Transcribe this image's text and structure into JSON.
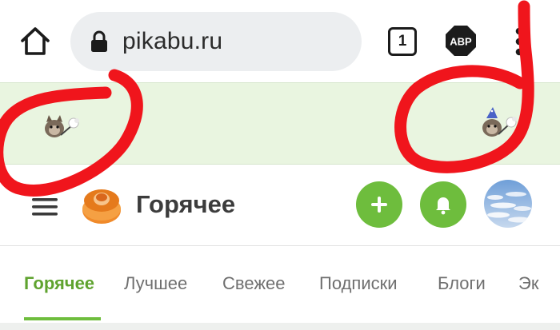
{
  "browser": {
    "url": "pikabu.ru",
    "tab_count": "1",
    "adblock_label": "ABP"
  },
  "header": {
    "title": "Горячее"
  },
  "nav": {
    "tabs": [
      {
        "label": "Горячее"
      },
      {
        "label": "Лучшее"
      },
      {
        "label": "Свежее"
      },
      {
        "label": "Подписки"
      },
      {
        "label": "Блоги"
      },
      {
        "label": "Эк"
      }
    ]
  },
  "colors": {
    "accent_green": "#6ebd3d",
    "active_tab": "#5fa32f",
    "banner_bg": "#e9f5e0",
    "annotation_red": "#f0151c"
  },
  "icons": {
    "home": "home-icon",
    "lock": "lock-icon",
    "tabs": "tabs-count-icon",
    "adblock": "abp-icon",
    "menu": "more-vert-icon",
    "hamburger": "hamburger-icon",
    "add": "plus-icon",
    "bell": "bell-icon"
  }
}
